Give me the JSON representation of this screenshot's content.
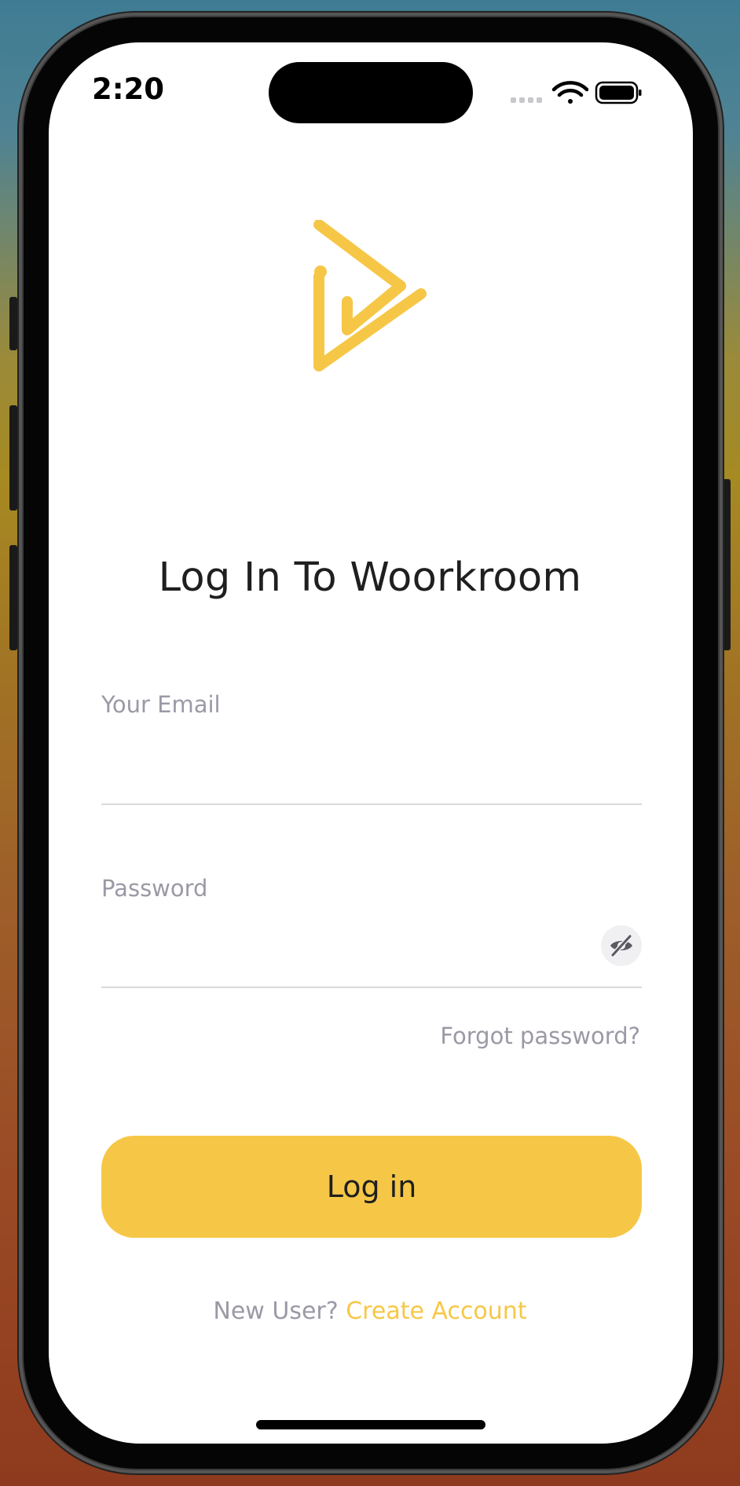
{
  "status_bar": {
    "time": "2:20",
    "icons": [
      "signal-icon",
      "wifi-icon",
      "battery-icon"
    ]
  },
  "logo": {
    "icon": "play-triangle-logo",
    "color": "#F6C747"
  },
  "title": "Log In To Woorkroom",
  "form": {
    "email": {
      "label": "Your Email",
      "value": "",
      "placeholder": ""
    },
    "password": {
      "label": "Password",
      "value": "",
      "placeholder": "",
      "toggle_icon": "eye-off-icon"
    },
    "forgot_label": "Forgot password?",
    "login_label": "Log in"
  },
  "footer": {
    "prompt": "New User?",
    "link": "Create Account"
  },
  "colors": {
    "accent": "#F6C747",
    "muted_text": "#9A9AA6",
    "heading": "#1F1F1F",
    "divider": "#D9D9DE"
  }
}
